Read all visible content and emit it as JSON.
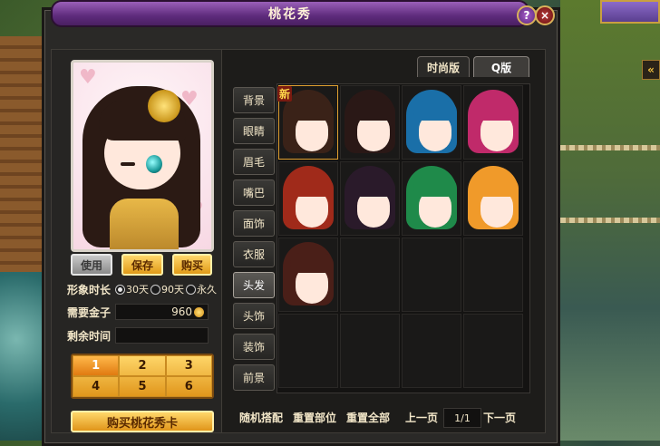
{
  "window": {
    "title": "桃花秀"
  },
  "title_buttons": {
    "help": "?",
    "close": "×"
  },
  "side_tab": {
    "label": "«"
  },
  "tabs": [
    {
      "label": "时尚版",
      "active": false
    },
    {
      "label": "Q版",
      "active": true
    }
  ],
  "actions": {
    "use": "使用",
    "save": "保存",
    "buy": "购买"
  },
  "duration": {
    "label": "形象时长",
    "options": [
      {
        "label": "30天",
        "checked": true
      },
      {
        "label": "90天",
        "checked": false
      },
      {
        "label": "永久",
        "checked": false
      }
    ]
  },
  "gold": {
    "label": "需要金子",
    "value": "960"
  },
  "remaining": {
    "label": "剩余时间",
    "value": ""
  },
  "pages": [
    "1",
    "2",
    "3",
    "4",
    "5",
    "6"
  ],
  "active_page": "1",
  "buy_card": "购买桃花秀卡",
  "categories": [
    {
      "label": "背景",
      "selected": false
    },
    {
      "label": "眼睛",
      "selected": false
    },
    {
      "label": "眉毛",
      "selected": false
    },
    {
      "label": "嘴巴",
      "selected": false
    },
    {
      "label": "面饰",
      "selected": false
    },
    {
      "label": "衣服",
      "selected": false
    },
    {
      "label": "头发",
      "selected": true
    },
    {
      "label": "头饰",
      "selected": false
    },
    {
      "label": "装饰",
      "selected": false
    },
    {
      "label": "前景",
      "selected": false
    }
  ],
  "items": [
    {
      "color": "#3a2218",
      "selected": true,
      "badge": "新"
    },
    {
      "color": "#2a1816",
      "selected": false
    },
    {
      "color": "#1a6fa8",
      "selected": false
    },
    {
      "color": "#c02a6a",
      "selected": false
    },
    {
      "color": "#a02a1a",
      "selected": false
    },
    {
      "color": "#2a1a2a",
      "selected": false
    },
    {
      "color": "#1f8a4a",
      "selected": false
    },
    {
      "color": "#f09a2a",
      "selected": false
    },
    {
      "color": "#4a1f18",
      "selected": false
    }
  ],
  "bottom": {
    "random": "随机搭配",
    "reset_part": "重置部位",
    "reset_all": "重置全部",
    "prev": "上一页",
    "page": "1/1",
    "next": "下一页"
  }
}
